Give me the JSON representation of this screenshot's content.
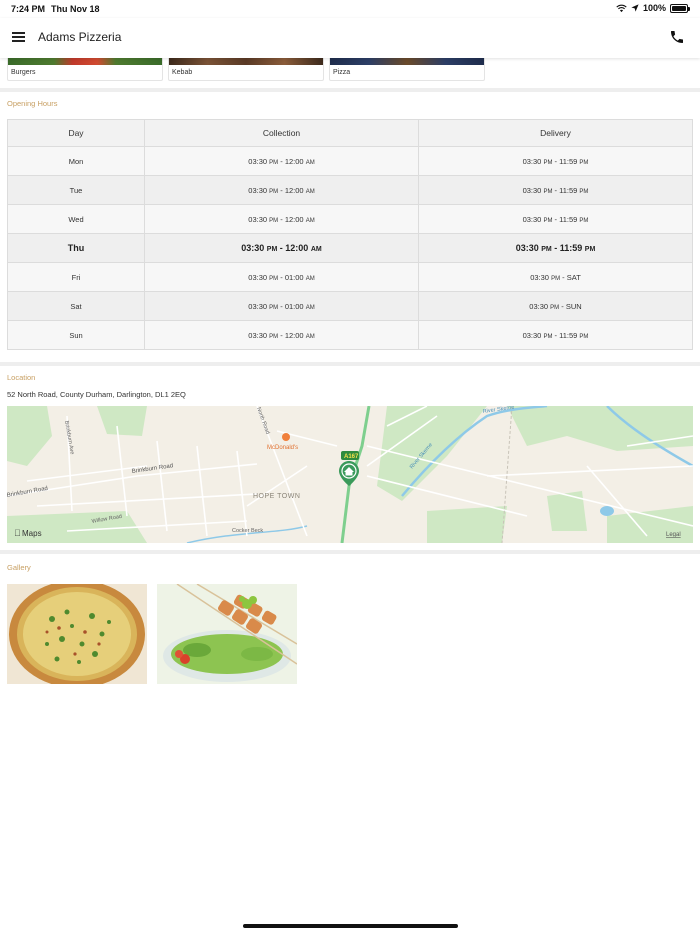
{
  "status_bar": {
    "time": "7:24 PM",
    "date": "Thu Nov 18",
    "battery": "100%",
    "battery_level": 1.0,
    "icons": [
      "wifi-icon",
      "location-arrow-icon",
      "battery-icon"
    ]
  },
  "nav": {
    "title": "Adams Pizzeria",
    "menu_icon": "hamburger-menu-icon",
    "call_icon": "phone-icon"
  },
  "categories": [
    {
      "label": "Burgers",
      "image_colors": [
        "#3a6b2a",
        "#c0392b",
        "#4e7a2f"
      ]
    },
    {
      "label": "Kebab",
      "image_colors": [
        "#5a3a26",
        "#7a5236",
        "#3d2a1c"
      ]
    },
    {
      "label": "Pizza",
      "image_colors": [
        "#2c3e66",
        "#6a4a2a",
        "#1f2d4d"
      ]
    }
  ],
  "opening_hours": {
    "title": "Opening Hours",
    "headers": {
      "day": "Day",
      "collection": "Collection",
      "delivery": "Delivery"
    },
    "rows": [
      {
        "day": "Mon",
        "c_start": "03:30",
        "c_start_ap": "PM",
        "c_end": "12:00",
        "c_end_ap": "AM",
        "d_start": "03:30",
        "d_start_ap": "PM",
        "d_end": "11:59",
        "d_end_ap": "PM"
      },
      {
        "day": "Tue",
        "c_start": "03:30",
        "c_start_ap": "PM",
        "c_end": "12:00",
        "c_end_ap": "AM",
        "d_start": "03:30",
        "d_start_ap": "PM",
        "d_end": "11:59",
        "d_end_ap": "PM"
      },
      {
        "day": "Wed",
        "c_start": "03:30",
        "c_start_ap": "PM",
        "c_end": "12:00",
        "c_end_ap": "AM",
        "d_start": "03:30",
        "d_start_ap": "PM",
        "d_end": "11:59",
        "d_end_ap": "PM"
      },
      {
        "day": "Thu",
        "c_start": "03:30",
        "c_start_ap": "PM",
        "c_end": "12:00",
        "c_end_ap": "AM",
        "d_start": "03:30",
        "d_start_ap": "PM",
        "d_end": "11:59",
        "d_end_ap": "PM"
      },
      {
        "day": "Fri",
        "c_start": "03:30",
        "c_start_ap": "PM",
        "c_end": "01:00",
        "c_end_ap": "AM",
        "d_start": "03:30",
        "d_start_ap": "PM",
        "d_end": "SAT",
        "d_end_ap": ""
      },
      {
        "day": "Sat",
        "c_start": "03:30",
        "c_start_ap": "PM",
        "c_end": "01:00",
        "c_end_ap": "AM",
        "d_start": "03:30",
        "d_start_ap": "PM",
        "d_end": "SUN",
        "d_end_ap": ""
      },
      {
        "day": "Sun",
        "c_start": "03:30",
        "c_start_ap": "PM",
        "c_end": "12:00",
        "c_end_ap": "AM",
        "d_start": "03:30",
        "d_start_ap": "PM",
        "d_end": "11:59",
        "d_end_ap": "PM"
      }
    ],
    "today": "Thu"
  },
  "location": {
    "title": "Location",
    "address": "52 North Road, County Durham, Darlington, DL1 2EQ",
    "map": {
      "road_labels": [
        "Brinkburn Road",
        "Brinkburn Road",
        "Brinkburn Ave",
        "Willow Road",
        "Cocker Beck",
        "North Road",
        "River Skerne",
        "River Skerne"
      ],
      "area_label": "HOPE TOWN",
      "poi_label": "McDonald's",
      "route_badge": "A167",
      "attribution": "Maps",
      "legal": "Legal",
      "colors": {
        "land": "#f3efe6",
        "park": "#cfe8c4",
        "water": "#8ec9e8",
        "main_road": "#7ecf8e",
        "road": "#ffffff"
      }
    }
  },
  "gallery": {
    "title": "Gallery",
    "images": [
      "pizza-photo",
      "kebab-skewer-photo"
    ]
  }
}
